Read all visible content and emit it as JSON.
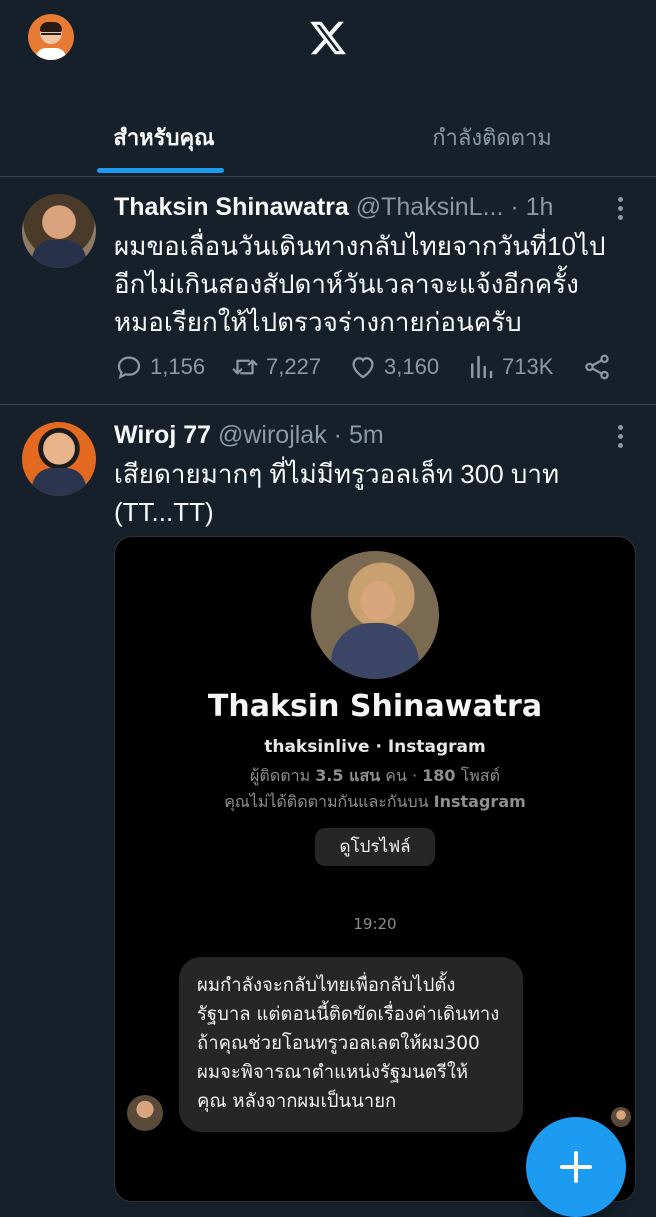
{
  "header": {
    "logo": "x-logo-icon"
  },
  "tabs": [
    {
      "label": "สำหรับคุณ",
      "active": true
    },
    {
      "label": "กำลังติดตาม",
      "active": false
    }
  ],
  "tweets": [
    {
      "name": "Thaksin Shinawatra",
      "handle": "@ThaksinL...",
      "separator": "·",
      "time": "1h",
      "lines": [
        "ผมขอเลื่อนวันเดินทางกลับไทยจากวันที่10ไป",
        "อีกไม่เกินสองสัปดาห์วันเวลาจะแจ้งอีกครั้ง",
        "หมอเรียกให้ไปตรวจร่างกายก่อนครับ"
      ],
      "replies": "1,156",
      "retweets": "7,227",
      "likes": "3,160",
      "views": "713K"
    },
    {
      "name": "Wiroj 77",
      "handle": "@wirojlak",
      "separator": "·",
      "time": "5m",
      "lines": [
        "เสียดายมากๆ ที่ไม่มีทรูวอลเล็ท 300 บาท",
        "(TT...TT)"
      ]
    }
  ],
  "embed": {
    "profile_name": "Thaksin Shinawatra",
    "username": "thaksinlive",
    "platform": "Instagram",
    "stats_prefix": "ผู้ติดตาม",
    "followers": "3.5 แสน",
    "followers_unit": "คน",
    "posts": "180",
    "posts_unit": "โพสต์",
    "mutual_text": "คุณไม่ได้ติดตามกันและกันบน",
    "mutual_platform": "Instagram",
    "view_profile": "ดูโปรไฟล์",
    "message_time": "19:20",
    "message_lines": [
      "ผมกำลังจะกลับไทยเพื่อกลับไปตั้ง",
      "รัฐบาล แต่ตอนนี้ติดขัดเรื่องค่าเดินทาง",
      "ถ้าคุณช่วยโอนทรูวอลเลตให้ผม300",
      "ผมจะพิจารณาตำแหน่งรัฐมนตรีให้",
      "คุณ หลังจากผมเป็นนายก"
    ]
  },
  "colors": {
    "background": "#15202b",
    "accent": "#1d9bf0",
    "muted": "#8b98a5",
    "divider": "#38444d"
  }
}
